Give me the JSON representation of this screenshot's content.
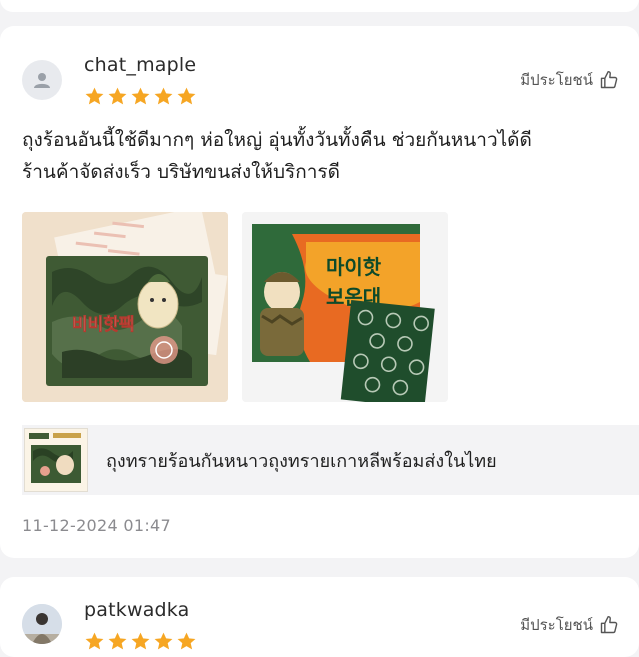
{
  "review_1": {
    "username": "chat_maple",
    "rating": 5,
    "helpful_label": "มีประโยชน์",
    "text_lines": [
      "ถุงร้อนอันนี้ใช้ดีมากๆ ห่อใหญ่ อุ่นทั้งวันทั้งคืน ช่วยกันหนาวได้ดี",
      "ร้านค้าจัดส่งเร็ว บริษัทขนส่งให้บริการดี"
    ],
    "photo_1_text": "비비핫팩",
    "photo_2_text": [
      "마이핫",
      "보온대"
    ],
    "product_name": "ถุงทรายร้อนกันหนาวถุงทรายเกาหลีพร้อมส่งในไทย",
    "timestamp": "11-12-2024 01:47"
  },
  "review_2": {
    "username": "patkwadka",
    "rating": 5,
    "helpful_label": "มีประโยชน์"
  },
  "colors": {
    "star": "#f6a623",
    "card": "#ffffff",
    "background": "#f3f3f5",
    "timestamp": "#8b8b8f"
  }
}
